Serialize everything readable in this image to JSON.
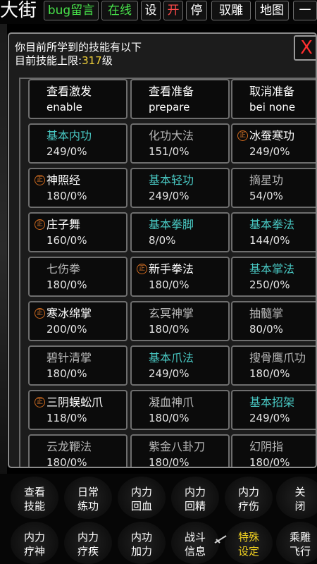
{
  "topbar": {
    "place": "大街",
    "buttons": [
      {
        "label": "bug留言",
        "color": "green"
      },
      {
        "label": "在线",
        "color": "green"
      },
      {
        "label": "设",
        "color": "white"
      },
      {
        "label": "开",
        "color": "red"
      },
      {
        "label": "停",
        "color": "white"
      },
      {
        "label": "驭雕",
        "color": "white"
      },
      {
        "label": "地图",
        "color": "white"
      },
      {
        "label": "一",
        "color": "white"
      }
    ]
  },
  "panel": {
    "line1": "你目前所学到的技能有以下",
    "limit_prefix": "目前技能上限:",
    "limit_value": "317",
    "limit_suffix": "级",
    "close_label": "X"
  },
  "commands": [
    {
      "name": "查看激发",
      "sub": "enable"
    },
    {
      "name": "查看准备",
      "sub": "prepare"
    },
    {
      "name": "取消准备",
      "sub": "bei none"
    }
  ],
  "seal_char": "正",
  "skills": [
    {
      "name": "基本内功",
      "level": "249/0%",
      "color": "cyan",
      "seal": false
    },
    {
      "name": "化功大法",
      "level": "151/0%",
      "color": "gray",
      "seal": false
    },
    {
      "name": "冰蚕寒功",
      "level": "249/0%",
      "color": "white",
      "seal": true
    },
    {
      "name": "神照经",
      "level": "180/0%",
      "color": "white",
      "seal": true
    },
    {
      "name": "基本轻功",
      "level": "249/0%",
      "color": "cyan",
      "seal": false
    },
    {
      "name": "摘星功",
      "level": "54/0%",
      "color": "gray",
      "seal": false
    },
    {
      "name": "庄子舞",
      "level": "160/0%",
      "color": "white",
      "seal": true
    },
    {
      "name": "基本拳脚",
      "level": "8/0%",
      "color": "cyan",
      "seal": false
    },
    {
      "name": "基本拳法",
      "level": "144/0%",
      "color": "cyan",
      "seal": false
    },
    {
      "name": "七伤拳",
      "level": "180/0%",
      "color": "gray",
      "seal": false
    },
    {
      "name": "新手拳法",
      "level": "180/0%",
      "color": "white",
      "seal": true
    },
    {
      "name": "基本掌法",
      "level": "250/0%",
      "color": "cyan",
      "seal": false
    },
    {
      "name": "寒冰绵掌",
      "level": "200/0%",
      "color": "white",
      "seal": true
    },
    {
      "name": "玄冥神掌",
      "level": "180/0%",
      "color": "gray",
      "seal": false
    },
    {
      "name": "抽髓掌",
      "level": "80/0%",
      "color": "gray",
      "seal": false
    },
    {
      "name": "碧针清掌",
      "level": "180/0%",
      "color": "gray",
      "seal": false
    },
    {
      "name": "基本爪法",
      "level": "249/0%",
      "color": "cyan",
      "seal": false
    },
    {
      "name": "搜骨鹰爪功",
      "level": "180/0%",
      "color": "gray",
      "seal": false
    },
    {
      "name": "三阴蜈蚣爪",
      "level": "118/0%",
      "color": "white",
      "seal": true
    },
    {
      "name": "凝血神爪",
      "level": "180/0%",
      "color": "gray",
      "seal": false
    },
    {
      "name": "基本招架",
      "level": "249/0%",
      "color": "cyan",
      "seal": false
    },
    {
      "name": "云龙鞭法",
      "level": "180/0%",
      "color": "gray",
      "seal": false
    },
    {
      "name": "紫金八卦刀",
      "level": "180/0%",
      "color": "gray",
      "seal": false
    },
    {
      "name": "幻阴指",
      "level": "180/0%",
      "color": "gray",
      "seal": false
    }
  ],
  "menu": [
    {
      "l1": "查看",
      "l2": "技能",
      "color": "white"
    },
    {
      "l1": "日常",
      "l2": "练功",
      "color": "white"
    },
    {
      "l1": "内力",
      "l2": "回血",
      "color": "white"
    },
    {
      "l1": "内力",
      "l2": "回精",
      "color": "white"
    },
    {
      "l1": "内力",
      "l2": "疗伤",
      "color": "white"
    },
    {
      "l1": "关",
      "l2": "闭",
      "color": "white"
    },
    {
      "l1": "内力",
      "l2": "疗神",
      "color": "white"
    },
    {
      "l1": "内力",
      "l2": "疗疾",
      "color": "white"
    },
    {
      "l1": "内功",
      "l2": "加力",
      "color": "white"
    },
    {
      "l1": "战斗",
      "l2": "信息",
      "color": "white"
    },
    {
      "l1": "特殊",
      "l2": "设定",
      "color": "yellow"
    },
    {
      "l1": "乘雕",
      "l2": "飞行",
      "color": "white"
    }
  ]
}
